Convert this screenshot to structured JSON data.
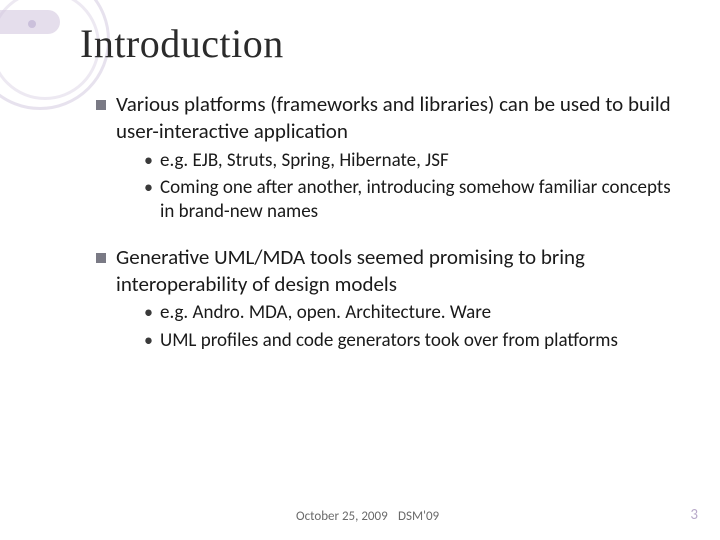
{
  "title": "Introduction",
  "bullets": [
    {
      "text": "Various platforms (frameworks and libraries) can be used to build user-interactive application",
      "sub": [
        "e.g. EJB, Struts, Spring, Hibernate, JSF",
        "Coming one after another, introducing somehow familiar concepts in brand-new names"
      ]
    },
    {
      "text": "Generative UML/MDA tools seemed promising to bring interoperability of design models",
      "sub": [
        "e.g. Andro. MDA, open. Architecture. Ware",
        "UML profiles and code generators took over from platforms"
      ]
    }
  ],
  "footer": {
    "date": "October 25, 2009",
    "event": "DSM'09",
    "page": "3"
  }
}
